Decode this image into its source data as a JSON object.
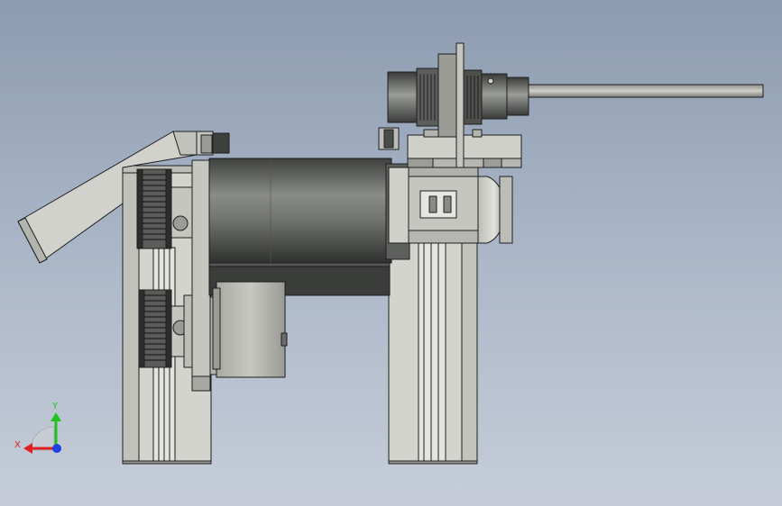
{
  "viewport": {
    "background_top": "#8d9bb0",
    "background_bottom": "#c6cdd9"
  },
  "model": {
    "view": "front",
    "colors": {
      "body_light": "#d6d6d0",
      "body_mid": "#b9b9b3",
      "body_dark": "#7e7e7a",
      "motor_dark": "#3a3c3a",
      "outline": "#1e1e1e"
    }
  },
  "triad": {
    "x_label": "X",
    "y_label": "Y",
    "x_color": "#e02020",
    "y_color": "#20c020",
    "z_color": "#2040e0"
  }
}
